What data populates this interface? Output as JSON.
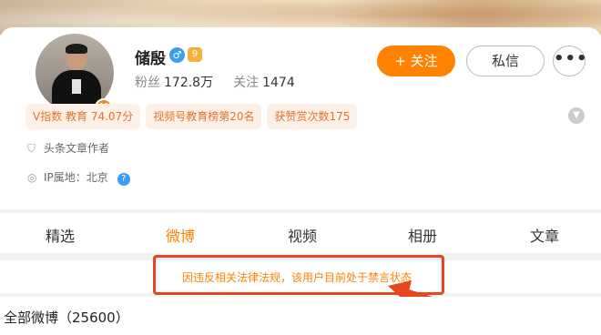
{
  "profile": {
    "name": "储殷",
    "verified_badge": "V",
    "gender_icon": "♂",
    "level_icon": "9",
    "followers_label": "粉丝",
    "followers_value": "172.8万",
    "following_label": "关注",
    "following_value": "1474"
  },
  "actions": {
    "follow_label": "+ 关注",
    "message_label": "私信",
    "more_label": "•••"
  },
  "tags": [
    {
      "label": "V指数 教育 74.07分"
    },
    {
      "label": "视频号教育榜第20名"
    },
    {
      "label": "获赞赏次数175"
    }
  ],
  "info": {
    "author_label": "头条文章作者",
    "ip_label": "IP属地：北京",
    "help_icon": "?"
  },
  "tabs": [
    {
      "label": "精选"
    },
    {
      "label": "微博"
    },
    {
      "label": "视频"
    },
    {
      "label": "相册"
    },
    {
      "label": "文章"
    }
  ],
  "active_tab": "微博",
  "notice": {
    "text": "因违反相关法律法规，该用户目前处于禁言状态"
  },
  "posts": {
    "all_label": "全部微博（25600）"
  },
  "colors": {
    "accent": "#ff8200",
    "tag_bg": "#fdf1e7",
    "tag_text": "#e3742a",
    "highlight": "#e8461c"
  },
  "icons": [
    "shield-icon",
    "location-icon",
    "help-icon",
    "chevron-down-icon",
    "gender-male-icon",
    "level-icon",
    "verified-icon"
  ]
}
